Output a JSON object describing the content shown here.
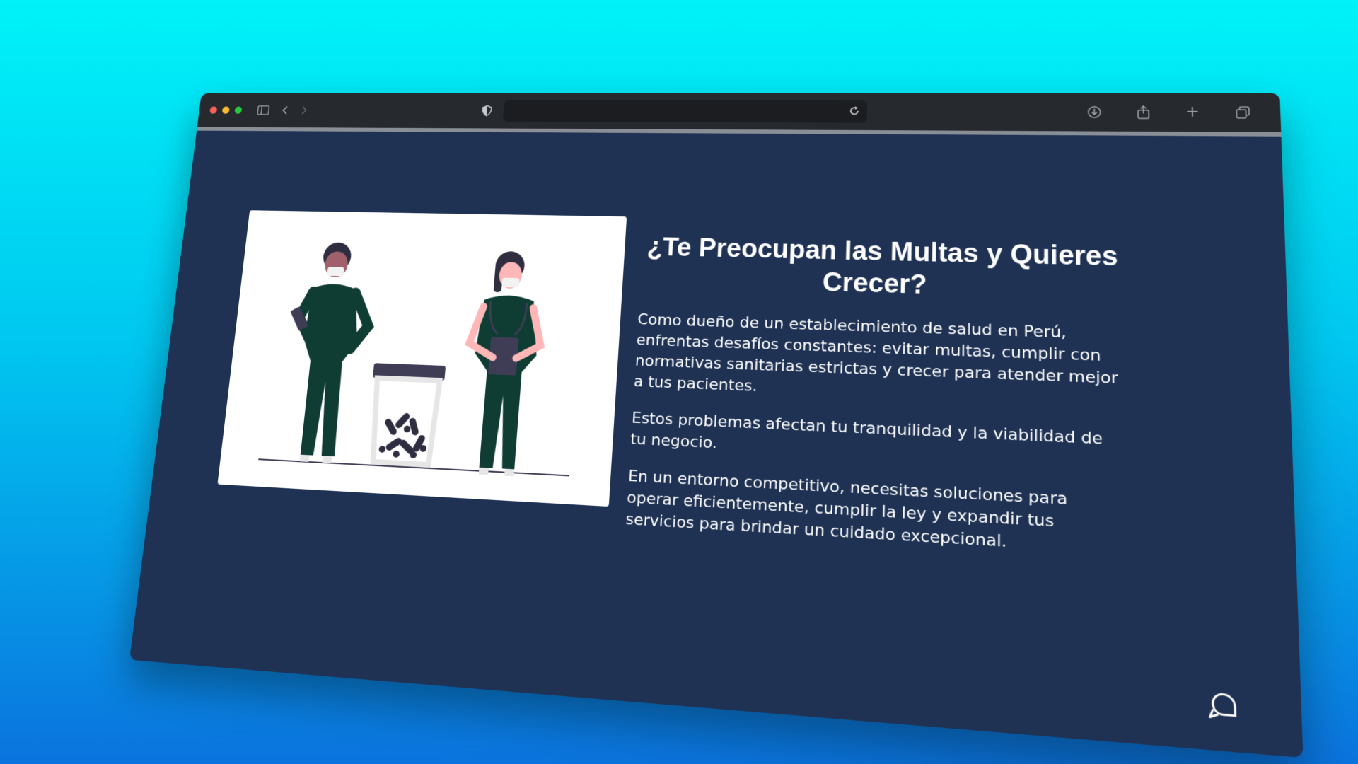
{
  "browser": {
    "address": "",
    "icons": [
      "sidebar-icon",
      "back-icon",
      "forward-icon",
      "shield-icon",
      "reload-icon",
      "download-icon",
      "share-icon",
      "new-tab-icon",
      "tabs-overview-icon"
    ]
  },
  "section": {
    "heading": "¿Te Preocupan las Multas y Quieres Crecer?",
    "paragraphs": [
      "Como dueño de un establecimiento de salud en Perú, enfrentas desafíos constantes: evitar multas, cumplir con normativas sanitarias estrictas y crecer para atender mejor a tus pacientes.",
      "Estos problemas afectan tu tranquilidad y la viabilidad de tu negocio.",
      "En un entorno competitivo, necesitas soluciones para operar eficientemente, cumplir la ley y expandir tus servicios para brindar un cuidado excepcional."
    ]
  },
  "colors": {
    "page_bg": "#1f3254",
    "scrubs": "#0f3d34",
    "toolbar": "#262a2f"
  },
  "help_widget": {
    "icon": "chat-help-icon"
  }
}
